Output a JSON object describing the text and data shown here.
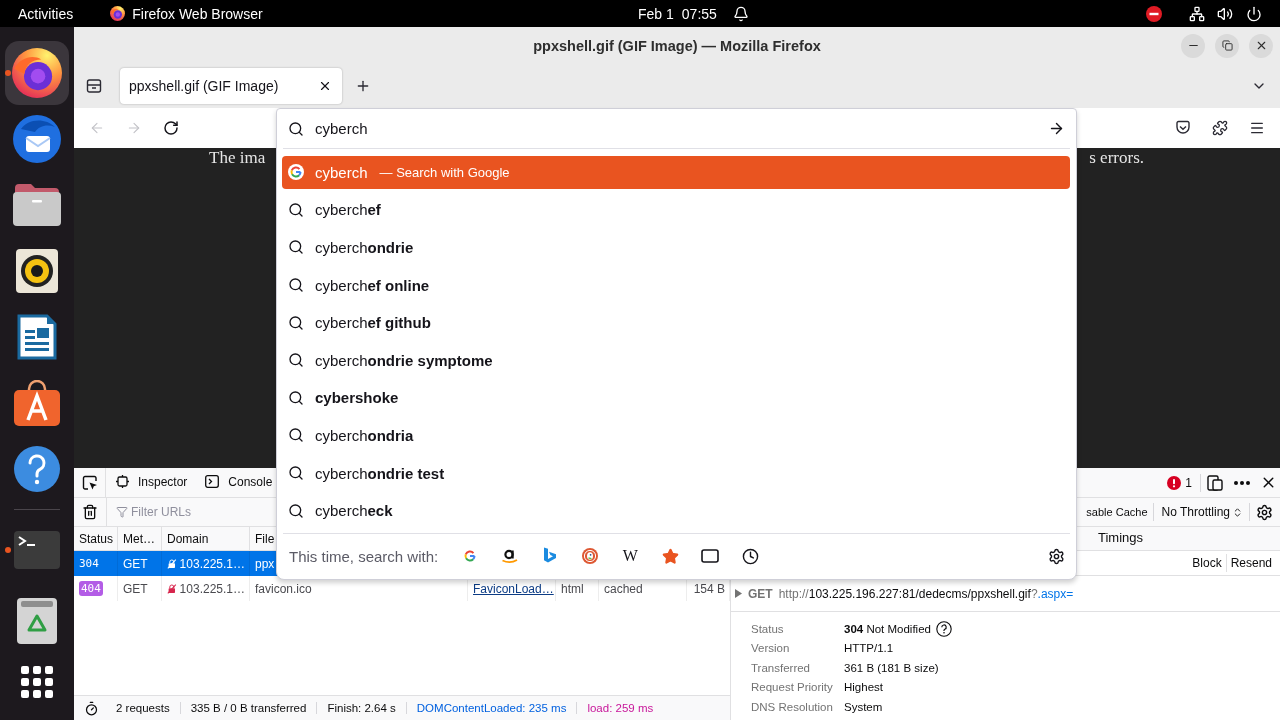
{
  "top_bar": {
    "activities": "Activities",
    "app_menu": "Firefox Web Browser",
    "date": "Feb 1",
    "time": "07:55"
  },
  "dock": {
    "items": [
      {
        "running": true,
        "selected": true
      },
      {
        "running": false,
        "selected": false
      },
      {
        "running": false,
        "selected": false
      },
      {
        "running": false,
        "selected": false
      },
      {
        "running": false,
        "selected": false
      },
      {
        "running": false,
        "selected": false
      },
      {
        "running": false,
        "selected": false
      },
      {
        "running": true,
        "selected": false
      },
      {
        "running": false,
        "selected": false
      }
    ]
  },
  "window": {
    "title": "ppxshell.gif (GIF Image) — Mozilla Firefox"
  },
  "tabs": [
    {
      "label": "ppxshell.gif (GIF Image)",
      "selected": true
    }
  ],
  "nav_buttons": [
    {
      "disabled": true
    },
    {
      "disabled": true
    },
    {
      "disabled": false
    }
  ],
  "address_bar": {
    "value": "cyberch"
  },
  "page": {
    "message_start": "The ima",
    "message_end": "s errors."
  },
  "url_dropdown": {
    "results": [
      {
        "kind": "search",
        "text": "cyberch",
        "action": "— Search with Google",
        "selected": true
      },
      {
        "kind": "suggestion",
        "text": "cyberch**ef**",
        "selected": false
      },
      {
        "kind": "suggestion",
        "text": "cyberch**ondrie**",
        "selected": false
      },
      {
        "kind": "suggestion",
        "text": "cyberch**ef online**",
        "selected": false
      },
      {
        "kind": "suggestion",
        "text": "cyberch**ef github**",
        "selected": false
      },
      {
        "kind": "suggestion",
        "text": "cyberch**ondrie symptome**",
        "selected": false
      },
      {
        "kind": "suggestion",
        "text": "**cybershoke**",
        "selected": false
      },
      {
        "kind": "suggestion",
        "text": "cyberch**ondria**",
        "selected": false
      },
      {
        "kind": "suggestion",
        "text": "cyberch**ondrie test**",
        "selected": false
      },
      {
        "kind": "suggestion",
        "text": "cyberch**eck**",
        "selected": false
      }
    ],
    "search_with": {
      "label": "This time, search with:",
      "text_engine": "W"
    }
  },
  "devtools": {
    "tabs": [
      {
        "label": "Inspector",
        "selected": false
      },
      {
        "label": "Console",
        "selected": false
      }
    ],
    "error_count": "1",
    "filter": {
      "placeholder": "Filter URLs"
    },
    "cache_label": "sable Cache",
    "throttling": "No Throttling",
    "table": {
      "columns": [
        "Status",
        "Met…",
        "Domain",
        "File"
      ],
      "rows": [
        {
          "selected": true,
          "cells": [
            "304",
            "GET",
            "103.225.1…",
            "ppx"
          ]
        },
        {
          "selected": false,
          "color": "#b35ce6",
          "cells": [
            "404",
            "GET",
            "103.225.1…",
            "favicon.ico",
            "FaviconLoad…",
            "html",
            "cached",
            "154 B"
          ]
        }
      ]
    },
    "details": {
      "tabs": [
        {
          "label": "Timings",
          "selected": false
        }
      ],
      "actions": [
        "Block",
        "Resend"
      ],
      "method": "GET",
      "url": {
        "scheme": "http://",
        "path": "103.225.196.227:81/dedecms/ppxshell.gif",
        "separator": "?",
        "query": ".aspx="
      },
      "fields": [
        {
          "label": "Status",
          "value": "**304** Not Modified",
          "help": true
        },
        {
          "label": "Version",
          "value": "HTTP/1.1",
          "help": false
        },
        {
          "label": "Transferred",
          "value": "361 B (181 B size)",
          "help": false
        },
        {
          "label": "Request Priority",
          "value": "Highest",
          "help": false
        },
        {
          "label": "DNS Resolution",
          "value": "System",
          "help": false
        }
      ]
    },
    "status_bar": {
      "requests": "2 requests",
      "transferred": "335 B / 0 B transferred",
      "finish": "Finish: 2.64 s",
      "dom_content_loaded": "DOMContentLoaded: 235 ms",
      "load": "load: 259 ms"
    }
  }
}
